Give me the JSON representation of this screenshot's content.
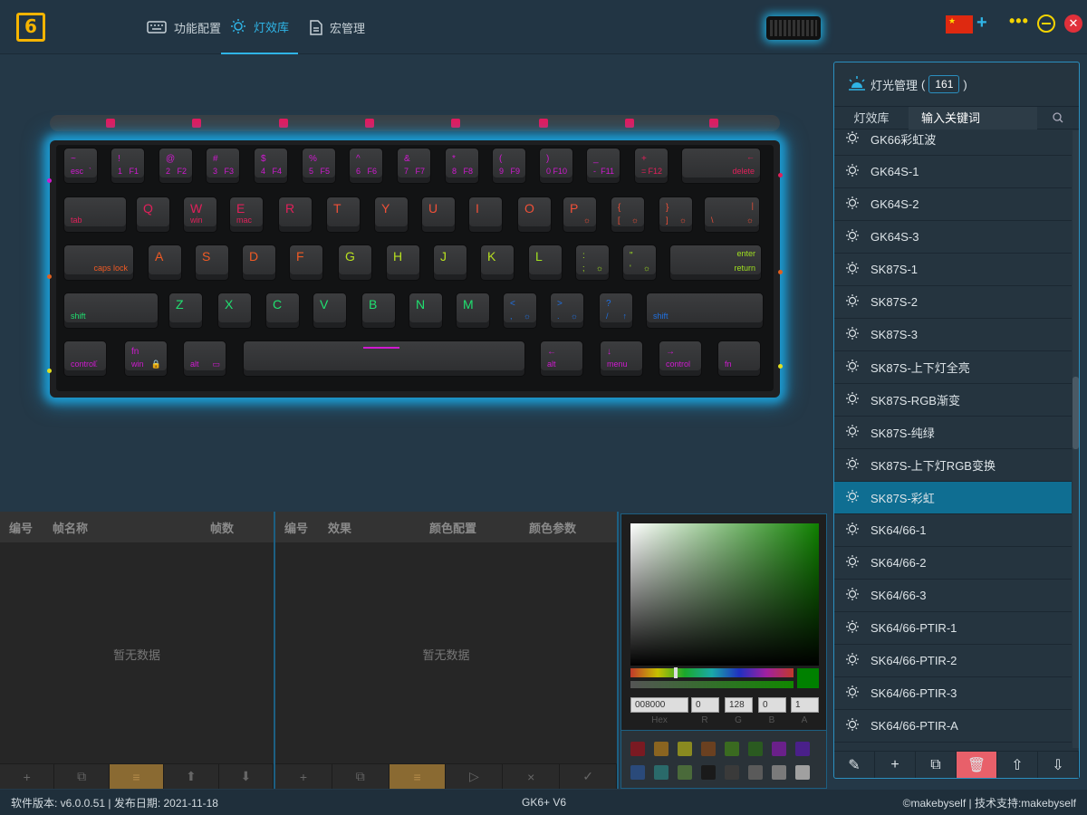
{
  "app": {
    "logo": "6"
  },
  "tabs": [
    {
      "label": "功能配置",
      "icon": "keyboard-icon"
    },
    {
      "label": "灯效库",
      "icon": "bulb-icon"
    },
    {
      "label": "宏管理",
      "icon": "document-icon"
    }
  ],
  "header": {
    "add_language": "+",
    "more": "•••",
    "close": "✕"
  },
  "keyboard": {
    "row1": [
      {
        "top": "~",
        "bottom": "esc",
        "sub": "`"
      },
      {
        "top": "!",
        "bottom": "1",
        "sub": "F1"
      },
      {
        "top": "@",
        "bottom": "2",
        "sub": "F2"
      },
      {
        "top": "#",
        "bottom": "3",
        "sub": "F3"
      },
      {
        "top": "$",
        "bottom": "4",
        "sub": "F4"
      },
      {
        "top": "%",
        "bottom": "5",
        "sub": "F5"
      },
      {
        "top": "^",
        "bottom": "6",
        "sub": "F6"
      },
      {
        "top": "&",
        "bottom": "7",
        "sub": "F7"
      },
      {
        "top": "*",
        "bottom": "8",
        "sub": "F8"
      },
      {
        "top": "(",
        "bottom": "9",
        "sub": "F9"
      },
      {
        "top": ")",
        "bottom": "0",
        "sub": "F10"
      },
      {
        "top": "_",
        "bottom": "-",
        "sub": "F11"
      },
      {
        "top": "+",
        "bottom": "=",
        "sub": "F12"
      },
      {
        "top": "←",
        "bottom": "delete",
        "sub": ""
      }
    ],
    "row2": [
      {
        "top": "",
        "bottom": "tab",
        "sub": ""
      },
      {
        "top": "Q",
        "bottom": "",
        "sub": ""
      },
      {
        "top": "W",
        "bottom": "win",
        "sub": ""
      },
      {
        "top": "E",
        "bottom": "mac",
        "sub": ""
      },
      {
        "top": "R",
        "bottom": "",
        "sub": ""
      },
      {
        "top": "T",
        "bottom": "",
        "sub": ""
      },
      {
        "top": "Y",
        "bottom": "",
        "sub": ""
      },
      {
        "top": "U",
        "bottom": "",
        "sub": ""
      },
      {
        "top": "I",
        "bottom": "",
        "sub": ""
      },
      {
        "top": "O",
        "bottom": "",
        "sub": ""
      },
      {
        "top": "P",
        "bottom": "",
        "sub": "☼"
      },
      {
        "top": "{",
        "bottom": "[",
        "sub": "☼"
      },
      {
        "top": "}",
        "bottom": "]",
        "sub": "☼"
      },
      {
        "top": "|",
        "bottom": "\\",
        "sub": "☼"
      }
    ],
    "row3": [
      {
        "top": "",
        "bottom": "caps lock",
        "sub": ""
      },
      {
        "top": "A",
        "bottom": "",
        "sub": ""
      },
      {
        "top": "S",
        "bottom": "",
        "sub": ""
      },
      {
        "top": "D",
        "bottom": "",
        "sub": ""
      },
      {
        "top": "F",
        "bottom": "",
        "sub": ""
      },
      {
        "top": "G",
        "bottom": "",
        "sub": ""
      },
      {
        "top": "H",
        "bottom": "",
        "sub": ""
      },
      {
        "top": "J",
        "bottom": "",
        "sub": ""
      },
      {
        "top": "K",
        "bottom": "",
        "sub": ""
      },
      {
        "top": "L",
        "bottom": "",
        "sub": ""
      },
      {
        "top": ":",
        "bottom": ";",
        "sub": "☼"
      },
      {
        "top": "\"",
        "bottom": "'",
        "sub": "☼"
      },
      {
        "top": "enter",
        "bottom": "return",
        "sub": ""
      }
    ],
    "row4": [
      {
        "top": "",
        "bottom": "shift",
        "sub": ""
      },
      {
        "top": "Z",
        "bottom": "",
        "sub": ""
      },
      {
        "top": "X",
        "bottom": "",
        "sub": ""
      },
      {
        "top": "C",
        "bottom": "",
        "sub": ""
      },
      {
        "top": "V",
        "bottom": "",
        "sub": ""
      },
      {
        "top": "B",
        "bottom": "",
        "sub": ""
      },
      {
        "top": "N",
        "bottom": "",
        "sub": ""
      },
      {
        "top": "M",
        "bottom": "",
        "sub": ""
      },
      {
        "top": "<",
        "bottom": ",",
        "sub": "☼"
      },
      {
        "top": ">",
        "bottom": ".",
        "sub": "☼"
      },
      {
        "top": "?",
        "bottom": "/",
        "sub": "↑"
      },
      {
        "top": "",
        "bottom": "shift",
        "sub": ""
      }
    ],
    "row5": [
      {
        "top": "",
        "bottom": "control",
        "sub": "☾"
      },
      {
        "top": "fn",
        "bottom": "win",
        "sub": "🔒"
      },
      {
        "top": "",
        "bottom": "alt",
        "sub": "▭"
      },
      {
        "top": "",
        "bottom": "",
        "sub": ""
      },
      {
        "top": "←",
        "bottom": "alt",
        "sub": ""
      },
      {
        "top": "↓",
        "bottom": "menu",
        "sub": ""
      },
      {
        "top": "→",
        "bottom": "control",
        "sub": ""
      },
      {
        "top": "",
        "bottom": "fn",
        "sub": ""
      }
    ]
  },
  "light_panel": {
    "title": "灯光管理",
    "paren_open": "(",
    "paren_close": ")",
    "count": "161",
    "search_label": "灯效库",
    "search_placeholder": "输入关键词",
    "items": [
      "GK66彩虹波",
      "GK64S-1",
      "GK64S-2",
      "GK64S-3",
      "SK87S-1",
      "SK87S-2",
      "SK87S-3",
      "SK87S-上下灯全亮",
      "SK87S-RGB渐变",
      "SK87S-纯绿",
      "SK87S-上下灯RGB变换",
      "SK87S-彩虹",
      "SK64/66-1",
      "SK64/66-2",
      "SK64/66-3",
      "SK64/66-PTIR-1",
      "SK64/66-PTIR-2",
      "SK64/66-PTIR-3",
      "SK64/66-PTIR-A"
    ],
    "selected_index": 11,
    "toolbar": [
      "✎",
      "+",
      "⧉",
      "🗑",
      "⇧",
      "⇩"
    ]
  },
  "frames_panel": {
    "headers": [
      "编号",
      "帧名称",
      "帧数"
    ],
    "empty": "暂无数据",
    "toolbar": [
      "+",
      "⧉",
      "≡",
      "⬆",
      "⬇"
    ]
  },
  "effects_panel": {
    "headers": [
      "编号",
      "效果",
      "颜色配置",
      "颜色参数"
    ],
    "empty": "暂无数据",
    "toolbar": [
      "+",
      "⧉",
      "≡",
      "▷",
      "×",
      "✓"
    ]
  },
  "color_picker": {
    "hex": "008000",
    "r": "0",
    "g": "128",
    "b": "0",
    "a": "1",
    "labels": [
      "Hex",
      "R",
      "G",
      "B",
      "A"
    ],
    "current_color": "#008000",
    "swatches": [
      "#7a1a22",
      "#8a6420",
      "#8a8a20",
      "#6a4020",
      "#3a6a20",
      "#2a5a20",
      "#6a208a",
      "#4a208a",
      "#2a4a7a",
      "#2a6a6a",
      "#4a6a3a",
      "#1a1a1a",
      "#3a3a3a",
      "#5a5a5a",
      "#7a7a7a",
      "#a0a0a0"
    ]
  },
  "status": {
    "version": "软件版本: v6.0.0.51 | 发布日期: 2021-11-18",
    "model": "GK6+ V6",
    "copyright": "©makebyself | 技术支持:makebyself"
  },
  "colors": {
    "accent": "#2fb4e6",
    "selected_row": "#0f6e92",
    "panel_border": "#2b8fbf"
  }
}
